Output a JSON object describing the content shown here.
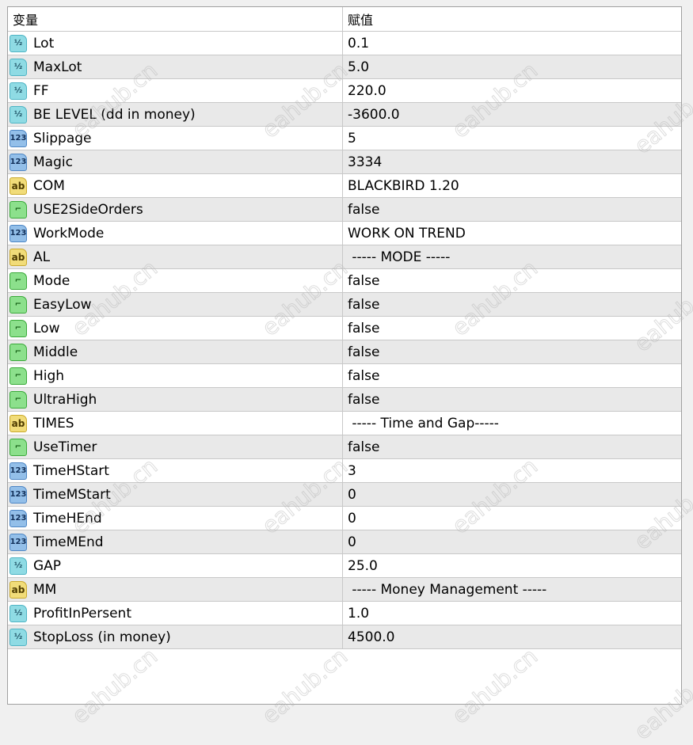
{
  "header": {
    "col_name": "变量",
    "col_value": "赋值"
  },
  "type_icons": {
    "double": "½",
    "int": "123",
    "string": "ab",
    "bool": "⌐"
  },
  "watermark": "eahub.cn",
  "rows": [
    {
      "type": "double",
      "name": "Lot",
      "value": "0.1"
    },
    {
      "type": "double",
      "name": "MaxLot",
      "value": "5.0"
    },
    {
      "type": "double",
      "name": "FF",
      "value": "220.0"
    },
    {
      "type": "double",
      "name": "BE LEVEL (dd in money)",
      "value": "-3600.0"
    },
    {
      "type": "int",
      "name": "Slippage",
      "value": "5"
    },
    {
      "type": "int",
      "name": "Magic",
      "value": "3334"
    },
    {
      "type": "string",
      "name": "COM",
      "value": "BLACKBIRD 1.20"
    },
    {
      "type": "bool",
      "name": "USE2SideOrders",
      "value": "false"
    },
    {
      "type": "int",
      "name": "WorkMode",
      "value": "WORK ON TREND"
    },
    {
      "type": "string",
      "name": "AL",
      "value": " ----- MODE -----"
    },
    {
      "type": "bool",
      "name": "Mode",
      "value": "false"
    },
    {
      "type": "bool",
      "name": "EasyLow",
      "value": "false"
    },
    {
      "type": "bool",
      "name": "Low",
      "value": "false"
    },
    {
      "type": "bool",
      "name": "Middle",
      "value": "false"
    },
    {
      "type": "bool",
      "name": "High",
      "value": "false"
    },
    {
      "type": "bool",
      "name": "UltraHigh",
      "value": "false"
    },
    {
      "type": "string",
      "name": "TIMES",
      "value": " ----- Time and Gap-----"
    },
    {
      "type": "bool",
      "name": "UseTimer",
      "value": "false"
    },
    {
      "type": "int",
      "name": "TimeHStart",
      "value": "3"
    },
    {
      "type": "int",
      "name": "TimeMStart",
      "value": "0"
    },
    {
      "type": "int",
      "name": "TimeHEnd",
      "value": "0"
    },
    {
      "type": "int",
      "name": "TimeMEnd",
      "value": "0"
    },
    {
      "type": "double",
      "name": "GAP",
      "value": "25.0"
    },
    {
      "type": "string",
      "name": "MM",
      "value": " ----- Money Management -----"
    },
    {
      "type": "double",
      "name": "ProfitInPersent",
      "value": "1.0"
    },
    {
      "type": "double",
      "name": "StopLoss (in money)",
      "value": "4500.0"
    }
  ]
}
